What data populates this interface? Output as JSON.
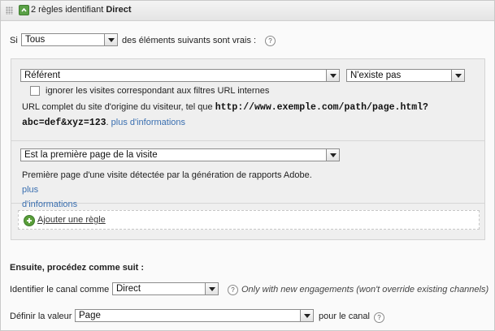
{
  "header": {
    "title_prefix": "2 règles identifiant",
    "title_bold": "Direct"
  },
  "condition": {
    "si_label": "Si",
    "match_value": "Tous",
    "suffix": "des éléments suivants sont vrais :"
  },
  "rules": [
    {
      "field": "Référent",
      "operator": "N'existe pas",
      "checkbox_label": "ignorer les visites correspondant aux filtres URL internes",
      "desc_line1": "URL complet du site d'origine du visiteur, tel que",
      "desc_code1": "http://www.exemple.com/path/page.html?",
      "desc_code2": "abc=def&xyz=123",
      "desc_after_code": ".",
      "more_link": "plus d'informations"
    },
    {
      "field": "Est la première page de la visite",
      "desc_line1": "Première page d'une visite détectée par la génération de rapports Adobe.",
      "more_link_1": "plus",
      "more_link_2": "d'informations"
    }
  ],
  "add_rule_label": "Ajouter une règle",
  "then": {
    "heading": "Ensuite, procédez comme suit :",
    "channel_label": "Identifier le canal comme",
    "channel_value": "Direct",
    "channel_note": "Only with new engagements (won't override existing channels)",
    "value_label": "Définir la valeur",
    "value_value": "Page",
    "value_suffix": "pour le canal"
  },
  "icons": {
    "help": "help-icon",
    "collapse": "collapse-icon",
    "grip": "drag-grip-icon",
    "add": "add-circle-icon"
  },
  "colors": {
    "link": "#3a6fb0",
    "add_icon": "#5a9e3a",
    "header_bg": "#e8e8e8"
  }
}
